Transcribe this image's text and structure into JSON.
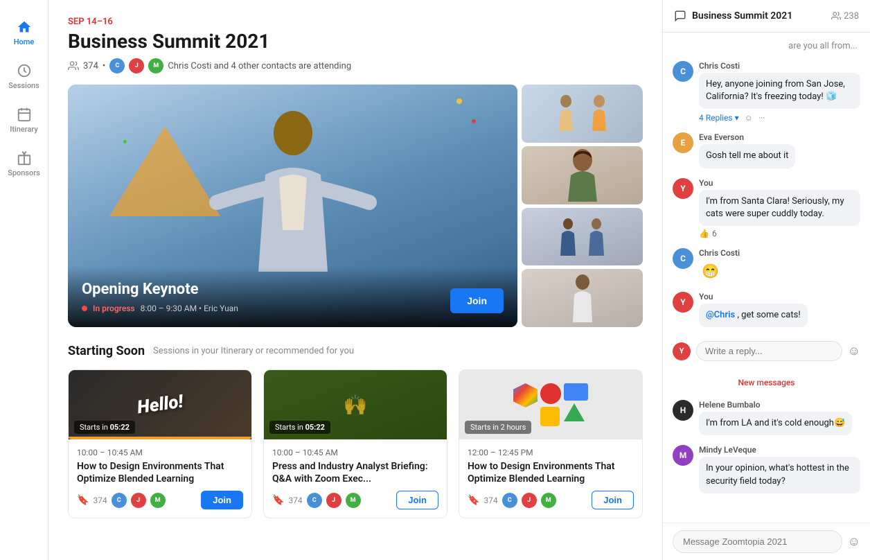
{
  "sidebar": {
    "items": [
      {
        "id": "home",
        "label": "Home",
        "icon": "home",
        "active": true
      },
      {
        "id": "sessions",
        "label": "Sessions",
        "icon": "clock",
        "active": false
      },
      {
        "id": "itinerary",
        "label": "Itinerary",
        "icon": "calendar",
        "active": false
      },
      {
        "id": "sponsors",
        "label": "Sponsors",
        "icon": "gift",
        "active": false
      }
    ]
  },
  "event": {
    "date": "SEP 14–16",
    "title": "Business Summit 2021",
    "attendees_count": "374",
    "attendees_text": "Chris Costi and 4 other contacts are attending"
  },
  "hero": {
    "keynote_title": "Opening Keynote",
    "status": "In progress",
    "time": "8:00 – 9:30 AM",
    "presenter": "Eric Yuan",
    "join_label": "Join"
  },
  "starting_soon": {
    "heading": "Starting Soon",
    "subtext": "Sessions in your Itinerary or recommended for you",
    "sessions": [
      {
        "countdown_label": "Starts in",
        "countdown": "05:22",
        "time": "10:00 – 10:45 AM",
        "title": "How to Design Environments That Optimize Blended Learning",
        "count": "374",
        "join_label": "Join",
        "join_filled": true,
        "thumb_type": "hello"
      },
      {
        "countdown_label": "Starts in",
        "countdown": "05:22",
        "time": "10:00 – 10:45 AM",
        "title": "Press and Industry Analyst Briefing: Q&A with Zoom Exec...",
        "count": "374",
        "join_label": "Join",
        "join_filled": false,
        "thumb_type": "crowd"
      },
      {
        "countdown_label": "Starts in",
        "countdown_text": "2 hours",
        "time": "12:00 – 12:45 PM",
        "title": "How to Design Environments That Optimize Blended Learning",
        "count": "374",
        "join_label": "Join",
        "join_filled": false,
        "thumb_type": "design"
      }
    ]
  },
  "chat": {
    "title": "Business Summit 2021",
    "count": "238",
    "messages": [
      {
        "id": "msg1",
        "sender": "",
        "text": "are you all from...",
        "type": "continuation",
        "avatar_type": "none"
      },
      {
        "id": "msg2",
        "sender": "Chris Costi",
        "text": "Hey, anyone joining from San Jose, California? It's freezing today! 🧊",
        "avatar_type": "chris",
        "replies_count": "4 Replies",
        "has_replies": true
      },
      {
        "id": "msg3",
        "sender": "Eva Everson",
        "text": "Gosh tell me about it",
        "avatar_type": "eva"
      },
      {
        "id": "msg4",
        "sender": "You",
        "text": "I'm from Santa Clara! Seriously, my cats were super cuddly today.",
        "avatar_type": "you",
        "reaction_emoji": "👍",
        "reaction_count": "6"
      },
      {
        "id": "msg5",
        "sender": "Chris Costi",
        "text": "😁",
        "avatar_type": "chris"
      },
      {
        "id": "msg6",
        "sender": "You",
        "text": "@Chris, get some cats!",
        "avatar_type": "you",
        "has_mention": true,
        "mention": "@Chris",
        "after_mention": ", get some cats!"
      }
    ],
    "reply_placeholder": "Write a reply...",
    "new_messages_label": "New messages",
    "extra_messages": [
      {
        "id": "msg7",
        "sender": "Helene Bumbalo",
        "text": "I'm from LA and it's cold enough😅",
        "avatar_type": "helene"
      },
      {
        "id": "msg8",
        "sender": "Mindy LeVeque",
        "text": "In your opinion, what's hottest in the security field today?",
        "avatar_type": "mindy"
      }
    ],
    "input_placeholder": "Message Zoomtopia 2021"
  }
}
